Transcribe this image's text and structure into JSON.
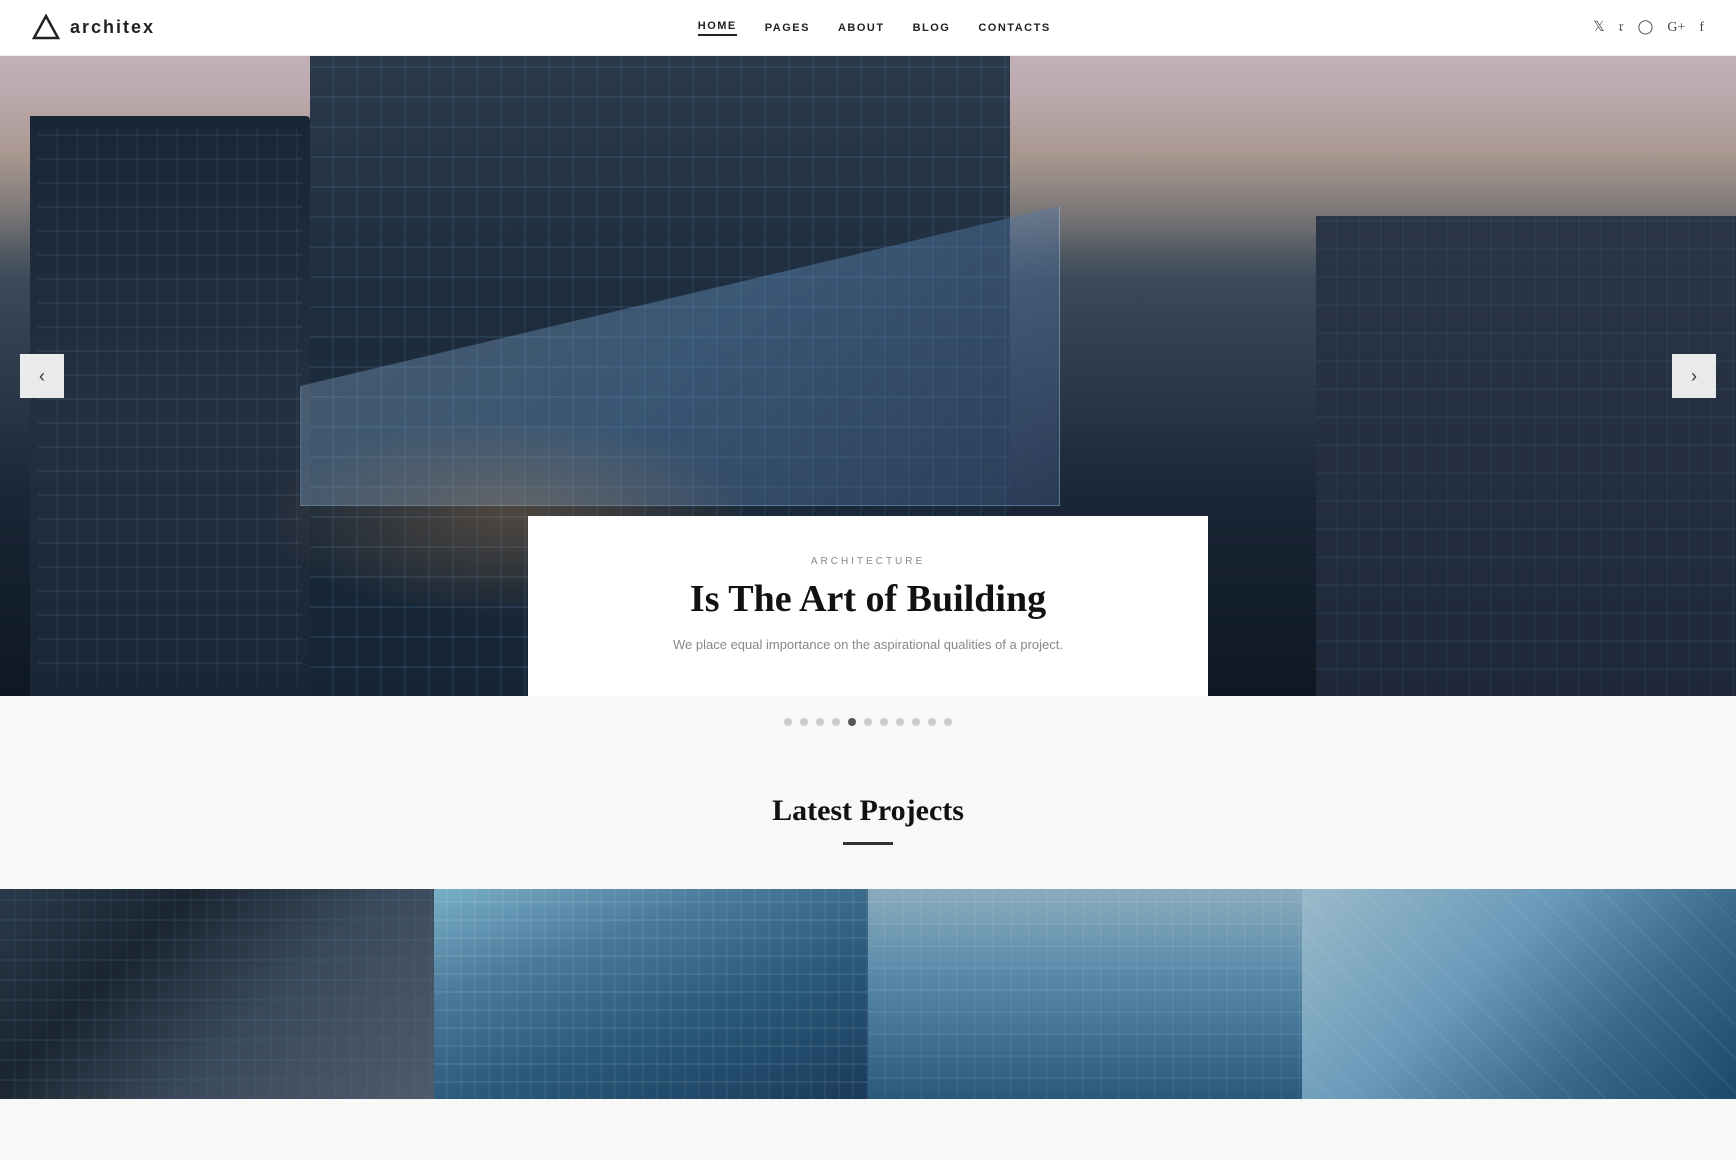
{
  "site": {
    "logo_text": "architex",
    "logo_icon_label": "triangle-icon"
  },
  "nav": {
    "links": [
      {
        "label": "HOME",
        "active": true
      },
      {
        "label": "PAGES",
        "active": false
      },
      {
        "label": "ABOUT",
        "active": false
      },
      {
        "label": "BLOG",
        "active": false
      },
      {
        "label": "CONTACTS",
        "active": false
      }
    ]
  },
  "social": {
    "twitter": "𝕏",
    "pinterest": "𝙋",
    "instagram": "📷",
    "googleplus": "G+",
    "facebook": "f"
  },
  "hero": {
    "prev_label": "‹",
    "next_label": "›",
    "slides": [
      {
        "category": "ARCHITECTURE",
        "title": "Is The Art of Building",
        "description": "We place equal importance on the aspirational qualities of a project."
      }
    ],
    "dots": [
      1,
      2,
      3,
      4,
      5,
      6,
      7,
      8,
      9,
      10,
      11
    ]
  },
  "latest_projects": {
    "section_title": "Latest Projects",
    "projects": [
      {
        "id": 1,
        "alt": "Project 1 - dark building facade"
      },
      {
        "id": 2,
        "alt": "Project 2 - glass skyscraper"
      },
      {
        "id": 3,
        "alt": "Project 3 - modern building"
      },
      {
        "id": 4,
        "alt": "Project 4 - curved glass tower"
      }
    ]
  }
}
